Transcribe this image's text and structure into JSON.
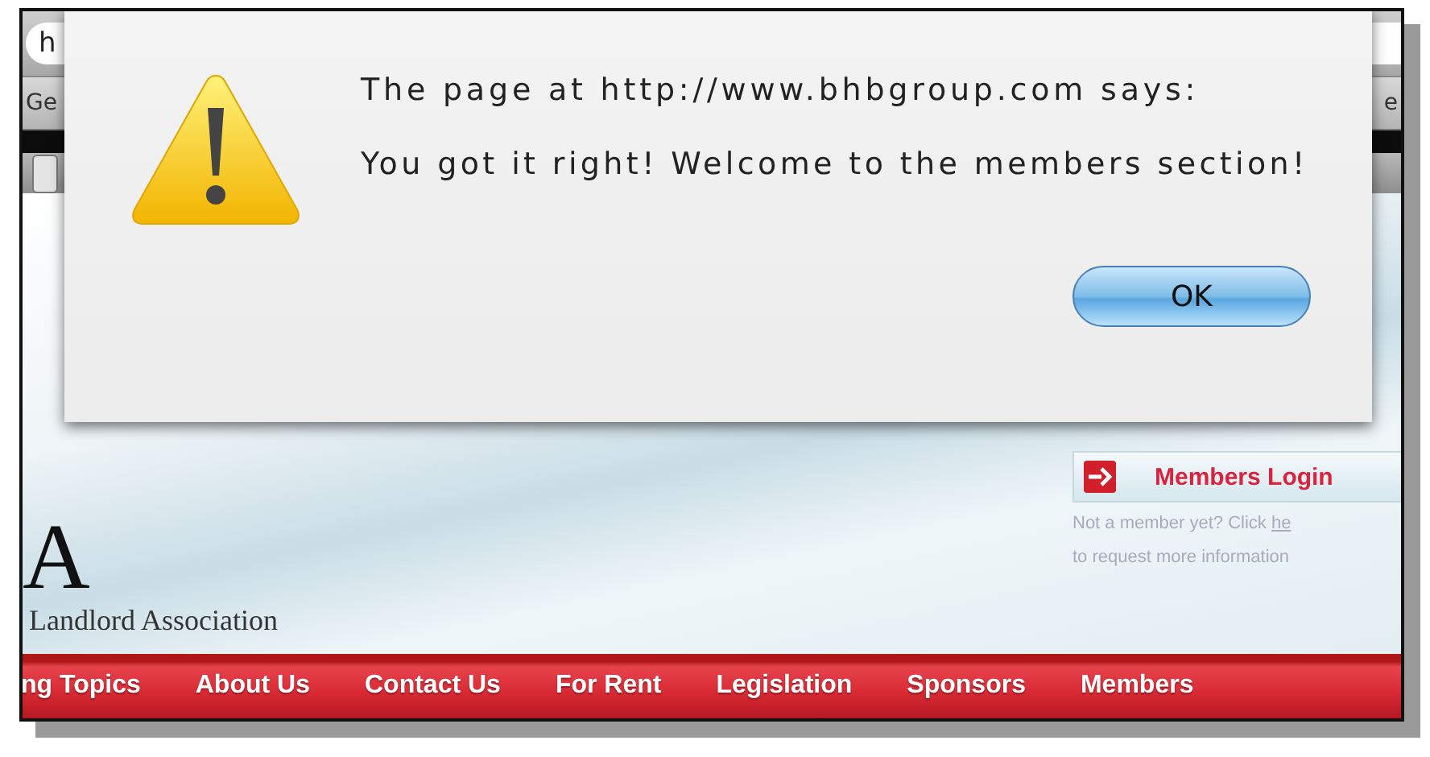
{
  "browser": {
    "address_text": "h",
    "bookmark_left": "Ge",
    "bookmark_right": "e"
  },
  "dialog": {
    "title": "The page at http://www.bhbgroup.com says:",
    "message": "You got it right! Welcome to the members section!",
    "button": "OK"
  },
  "site": {
    "logo_letter": "A",
    "logo_text": "Landlord Association",
    "login_label": "Members Login",
    "prompt": "Not a member yet? Click",
    "prompt_link": "he",
    "prompt_2": "to request more information"
  },
  "nav": [
    {
      "label": "ng Topics"
    },
    {
      "label": "About Us"
    },
    {
      "label": "Contact Us"
    },
    {
      "label": "For Rent"
    },
    {
      "label": "Legislation"
    },
    {
      "label": "Sponsors"
    },
    {
      "label": "Members"
    }
  ]
}
